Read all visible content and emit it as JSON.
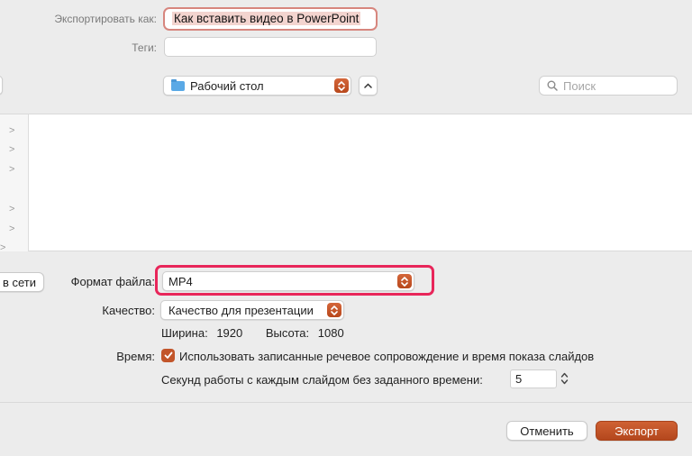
{
  "export_as": {
    "label": "Экспортировать как:",
    "value": "Как вставить видео в PowerPoint"
  },
  "tags": {
    "label": "Теги:",
    "value": ""
  },
  "location": {
    "selected": "Рабочий стол",
    "folder_icon": "folder-icon"
  },
  "search": {
    "placeholder": "Поиск",
    "icon": "magnifier-icon"
  },
  "sidebar_chevrons": [
    ">",
    ">",
    ">",
    ">",
    ">",
    ">"
  ],
  "network_button": "в сети",
  "format": {
    "label": "Формат файла:",
    "value": "MP4"
  },
  "quality": {
    "label": "Качество:",
    "value": "Качество для презентации"
  },
  "dimensions": {
    "width_label": "Ширина:",
    "width": "1920",
    "height_label": "Высота:",
    "height": "1080"
  },
  "timing": {
    "label": "Время:",
    "checkbox_label": "Использовать записанные речевое сопровождение и время показа слайдов",
    "checked": true,
    "seconds_label": "Секунд работы с каждым слайдом без заданного времени:",
    "seconds_value": "5"
  },
  "buttons": {
    "cancel": "Отменить",
    "export": "Экспорт"
  },
  "colors": {
    "accent": "#c2552a",
    "highlight_border": "#e8265a",
    "name_field_border": "#d7867e"
  }
}
